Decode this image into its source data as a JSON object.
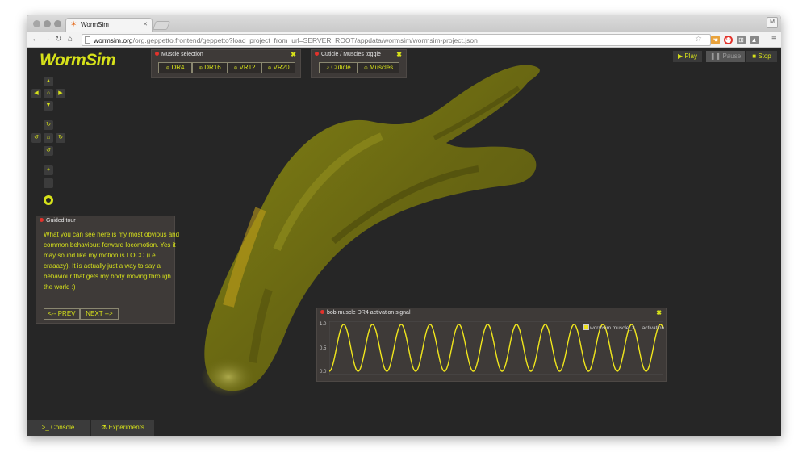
{
  "browser": {
    "tab_title": "WormSim",
    "url_host": "wormsim.org",
    "url_path": "/org.geppetto.frontend/geppetto?load_project_from_url=SERVER_ROOT/appdata/wormsim/wormsim-project.json",
    "profile_initial": "M"
  },
  "app": {
    "logo_text": "WormSim",
    "accent_color": "#d6e11a"
  },
  "muscle_selection": {
    "title": "Muscle selection",
    "buttons": [
      "DR4",
      "DR16",
      "VR12",
      "VR20"
    ]
  },
  "cuticle_toggle": {
    "title": "Cuticle / Muscles toggle",
    "buttons": [
      "Cuticle",
      "Muscles"
    ]
  },
  "sim_controls": {
    "play": "Play",
    "pause": "Pause",
    "stop": "Stop"
  },
  "guided_tour": {
    "title": "Guided tour",
    "text": "What you can see here is my most obvious and common behaviour: forward locomotion. Yes it may sound like my motion is LOCO (i.e. craaazy). It is actually just a way to say a behaviour that gets my body moving through the world :)",
    "prev": "<-- PREV",
    "next": "NEXT -->"
  },
  "signal_panel": {
    "title": "bob muscle DR4 activation signal",
    "legend": "wormsim.muscle_3.....activation",
    "y_ticks": [
      "1.0",
      "0.5",
      "0.0"
    ],
    "series_color": "#f0e61c",
    "ylim": [
      0,
      1
    ],
    "cycles": 11.6
  },
  "bottom_tabs": {
    "console": "Console",
    "experiments": "Experiments"
  }
}
